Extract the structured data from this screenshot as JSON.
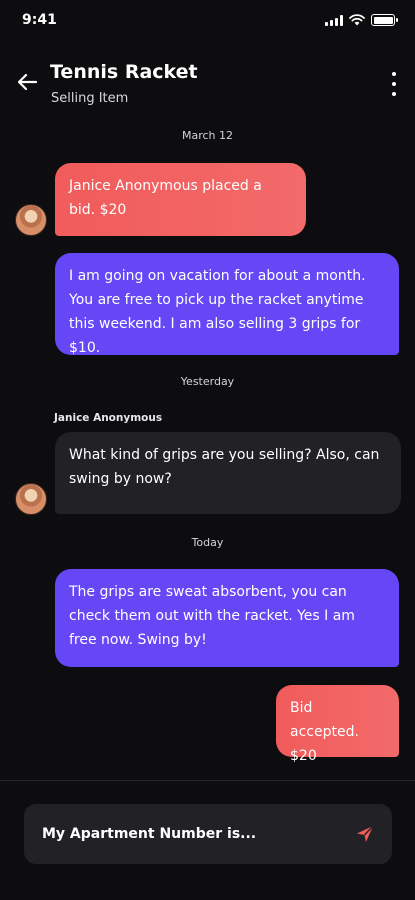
{
  "status_bar": {
    "time": "9:41",
    "icons": [
      "signal-icon",
      "wifi-icon",
      "battery-icon"
    ]
  },
  "header": {
    "title": "Tennis Racket",
    "subtitle": "Selling Item",
    "back_icon": "arrow-left-icon",
    "more_icon": "more-vertical-icon"
  },
  "dates": {
    "first": "March 12",
    "second": "Yesterday",
    "third": "Today"
  },
  "messages": [
    {
      "from": "other",
      "text": "Janice Anonymous placed a bid. $20"
    },
    {
      "from": "me",
      "text": "I am going on vacation for about a month. You are free to pick up the racket anytime this weekend. I am also selling 3 grips for $10."
    },
    {
      "from": "other",
      "sender": "Janice Anonymous",
      "text": "What kind of grips are you selling? Also, can swing by now?"
    },
    {
      "from": "me",
      "text": "The grips are sweat absorbent, you can check them out with the racket. Yes I am free now. Swing by!"
    },
    {
      "from": "me",
      "text": "Bid accepted. $20"
    }
  ],
  "composer": {
    "placeholder": "My Apartment Number is...",
    "send_icon": "send-icon"
  },
  "colors": {
    "background": "#0d0d0f",
    "bid_bubble": "#f15b5b",
    "my_bubble": "#6547f5",
    "their_bubble": "#212126",
    "send_icon": "#f25c5c"
  }
}
